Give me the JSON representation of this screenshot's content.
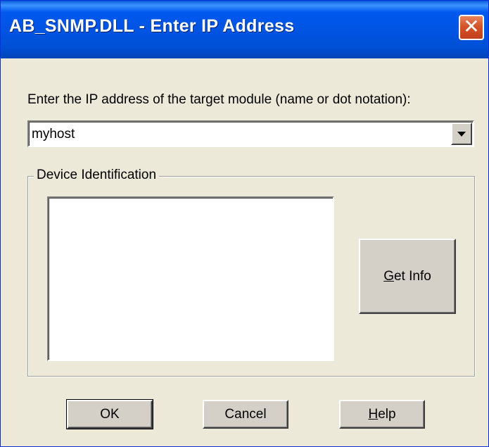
{
  "window": {
    "title": "AB_SNMP.DLL - Enter IP Address",
    "close_glyph": "✕"
  },
  "form": {
    "prompt_label": "Enter the IP address of the target module (name or dot notation):",
    "address_value": "myhost"
  },
  "group": {
    "caption": "Device Identification",
    "info_text": "",
    "get_info": {
      "mnemonic": "G",
      "rest": "et Info"
    }
  },
  "buttons": {
    "ok": "OK",
    "cancel": "Cancel",
    "help": {
      "mnemonic": "H",
      "rest": "elp"
    }
  },
  "icons": {
    "close": "close-icon",
    "dropdown": "chevron-down-icon"
  },
  "colors": {
    "titlebar": "#0054e3",
    "close_button": "#d6542a",
    "dialog_background": "#ece9d8",
    "button_face": "#d4d0c8"
  }
}
